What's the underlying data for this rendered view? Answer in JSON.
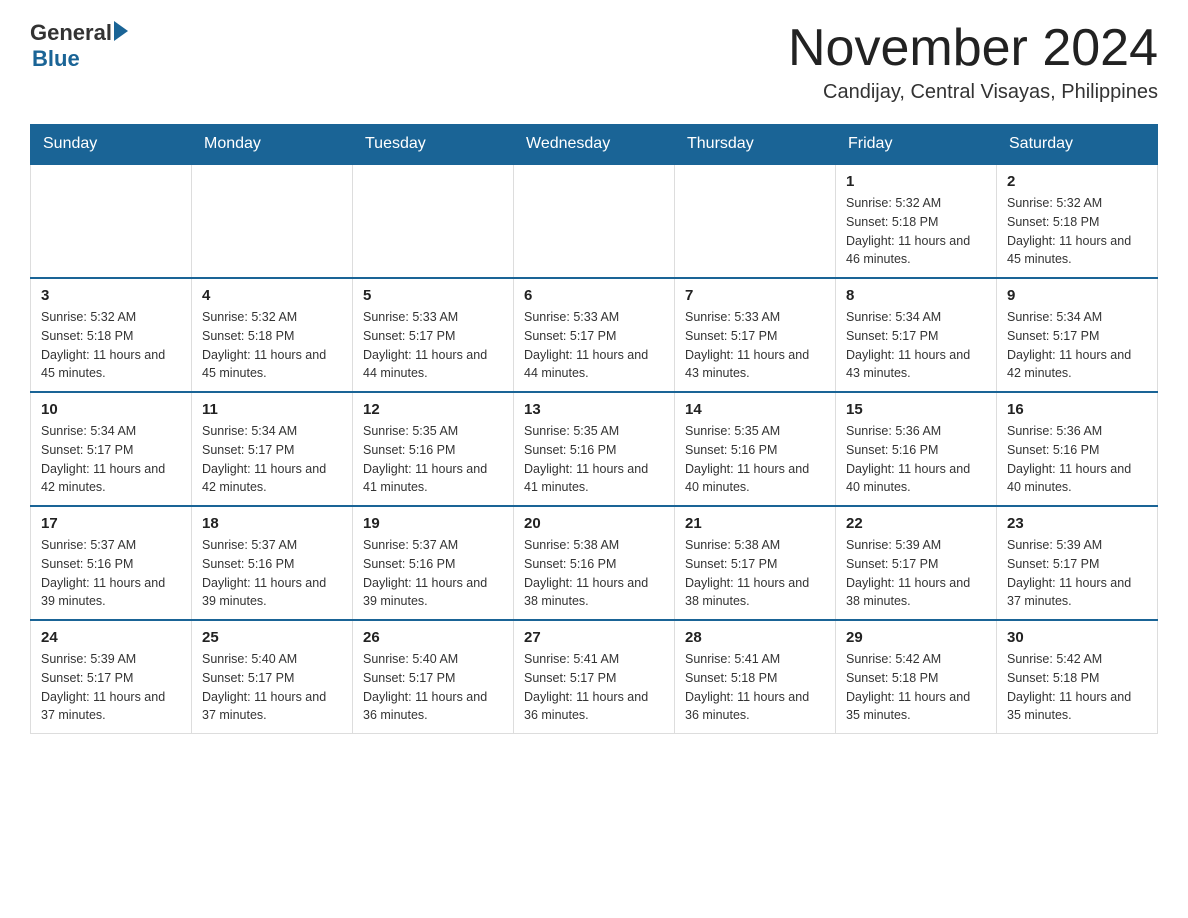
{
  "header": {
    "logo_general": "General",
    "logo_blue": "Blue",
    "month_title": "November 2024",
    "location": "Candijay, Central Visayas, Philippines"
  },
  "weekdays": [
    "Sunday",
    "Monday",
    "Tuesday",
    "Wednesday",
    "Thursday",
    "Friday",
    "Saturday"
  ],
  "weeks": [
    [
      {
        "day": "",
        "info": ""
      },
      {
        "day": "",
        "info": ""
      },
      {
        "day": "",
        "info": ""
      },
      {
        "day": "",
        "info": ""
      },
      {
        "day": "",
        "info": ""
      },
      {
        "day": "1",
        "info": "Sunrise: 5:32 AM\nSunset: 5:18 PM\nDaylight: 11 hours and 46 minutes."
      },
      {
        "day": "2",
        "info": "Sunrise: 5:32 AM\nSunset: 5:18 PM\nDaylight: 11 hours and 45 minutes."
      }
    ],
    [
      {
        "day": "3",
        "info": "Sunrise: 5:32 AM\nSunset: 5:18 PM\nDaylight: 11 hours and 45 minutes."
      },
      {
        "day": "4",
        "info": "Sunrise: 5:32 AM\nSunset: 5:18 PM\nDaylight: 11 hours and 45 minutes."
      },
      {
        "day": "5",
        "info": "Sunrise: 5:33 AM\nSunset: 5:17 PM\nDaylight: 11 hours and 44 minutes."
      },
      {
        "day": "6",
        "info": "Sunrise: 5:33 AM\nSunset: 5:17 PM\nDaylight: 11 hours and 44 minutes."
      },
      {
        "day": "7",
        "info": "Sunrise: 5:33 AM\nSunset: 5:17 PM\nDaylight: 11 hours and 43 minutes."
      },
      {
        "day": "8",
        "info": "Sunrise: 5:34 AM\nSunset: 5:17 PM\nDaylight: 11 hours and 43 minutes."
      },
      {
        "day": "9",
        "info": "Sunrise: 5:34 AM\nSunset: 5:17 PM\nDaylight: 11 hours and 42 minutes."
      }
    ],
    [
      {
        "day": "10",
        "info": "Sunrise: 5:34 AM\nSunset: 5:17 PM\nDaylight: 11 hours and 42 minutes."
      },
      {
        "day": "11",
        "info": "Sunrise: 5:34 AM\nSunset: 5:17 PM\nDaylight: 11 hours and 42 minutes."
      },
      {
        "day": "12",
        "info": "Sunrise: 5:35 AM\nSunset: 5:16 PM\nDaylight: 11 hours and 41 minutes."
      },
      {
        "day": "13",
        "info": "Sunrise: 5:35 AM\nSunset: 5:16 PM\nDaylight: 11 hours and 41 minutes."
      },
      {
        "day": "14",
        "info": "Sunrise: 5:35 AM\nSunset: 5:16 PM\nDaylight: 11 hours and 40 minutes."
      },
      {
        "day": "15",
        "info": "Sunrise: 5:36 AM\nSunset: 5:16 PM\nDaylight: 11 hours and 40 minutes."
      },
      {
        "day": "16",
        "info": "Sunrise: 5:36 AM\nSunset: 5:16 PM\nDaylight: 11 hours and 40 minutes."
      }
    ],
    [
      {
        "day": "17",
        "info": "Sunrise: 5:37 AM\nSunset: 5:16 PM\nDaylight: 11 hours and 39 minutes."
      },
      {
        "day": "18",
        "info": "Sunrise: 5:37 AM\nSunset: 5:16 PM\nDaylight: 11 hours and 39 minutes."
      },
      {
        "day": "19",
        "info": "Sunrise: 5:37 AM\nSunset: 5:16 PM\nDaylight: 11 hours and 39 minutes."
      },
      {
        "day": "20",
        "info": "Sunrise: 5:38 AM\nSunset: 5:16 PM\nDaylight: 11 hours and 38 minutes."
      },
      {
        "day": "21",
        "info": "Sunrise: 5:38 AM\nSunset: 5:17 PM\nDaylight: 11 hours and 38 minutes."
      },
      {
        "day": "22",
        "info": "Sunrise: 5:39 AM\nSunset: 5:17 PM\nDaylight: 11 hours and 38 minutes."
      },
      {
        "day": "23",
        "info": "Sunrise: 5:39 AM\nSunset: 5:17 PM\nDaylight: 11 hours and 37 minutes."
      }
    ],
    [
      {
        "day": "24",
        "info": "Sunrise: 5:39 AM\nSunset: 5:17 PM\nDaylight: 11 hours and 37 minutes."
      },
      {
        "day": "25",
        "info": "Sunrise: 5:40 AM\nSunset: 5:17 PM\nDaylight: 11 hours and 37 minutes."
      },
      {
        "day": "26",
        "info": "Sunrise: 5:40 AM\nSunset: 5:17 PM\nDaylight: 11 hours and 36 minutes."
      },
      {
        "day": "27",
        "info": "Sunrise: 5:41 AM\nSunset: 5:17 PM\nDaylight: 11 hours and 36 minutes."
      },
      {
        "day": "28",
        "info": "Sunrise: 5:41 AM\nSunset: 5:18 PM\nDaylight: 11 hours and 36 minutes."
      },
      {
        "day": "29",
        "info": "Sunrise: 5:42 AM\nSunset: 5:18 PM\nDaylight: 11 hours and 35 minutes."
      },
      {
        "day": "30",
        "info": "Sunrise: 5:42 AM\nSunset: 5:18 PM\nDaylight: 11 hours and 35 minutes."
      }
    ]
  ]
}
